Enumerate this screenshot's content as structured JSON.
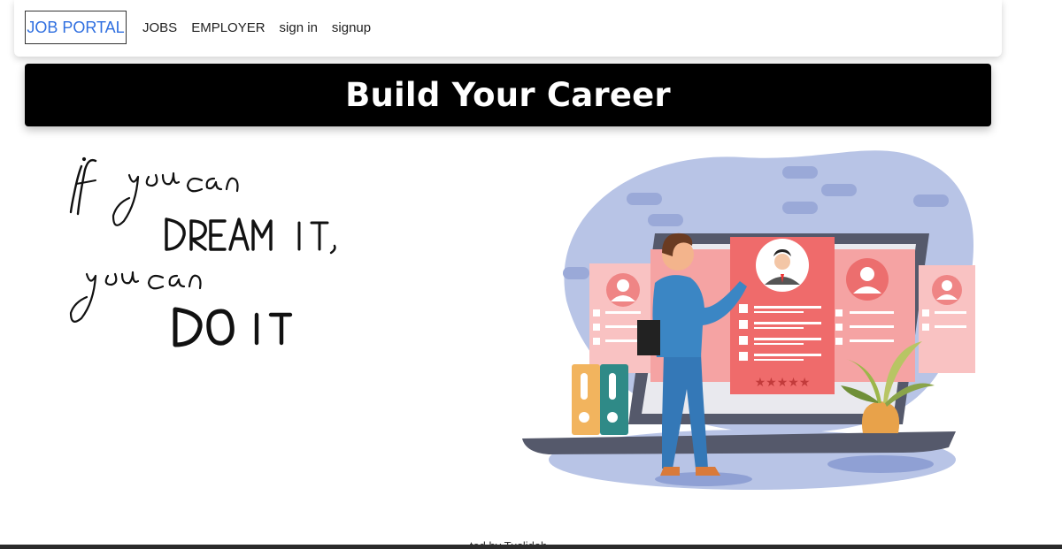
{
  "nav": {
    "brand": "JOB PORTAL",
    "links": [
      "JOBS",
      "EMPLOYER",
      "sign in",
      "signup"
    ]
  },
  "banner": {
    "title": "Build Your Career"
  },
  "quote": {
    "lines": [
      "if you can",
      "DREAM IT,",
      "you can",
      "DO IT"
    ]
  },
  "footer": {
    "text": "...ted by Tuslidah..."
  },
  "colors": {
    "brand": "#2f6fe0",
    "banner_bg": "#000000",
    "blob": "#b8c4e6",
    "card_red": "#ef6b6b",
    "card_pink": "#f9c2c2",
    "suit": "#3b86c4"
  }
}
